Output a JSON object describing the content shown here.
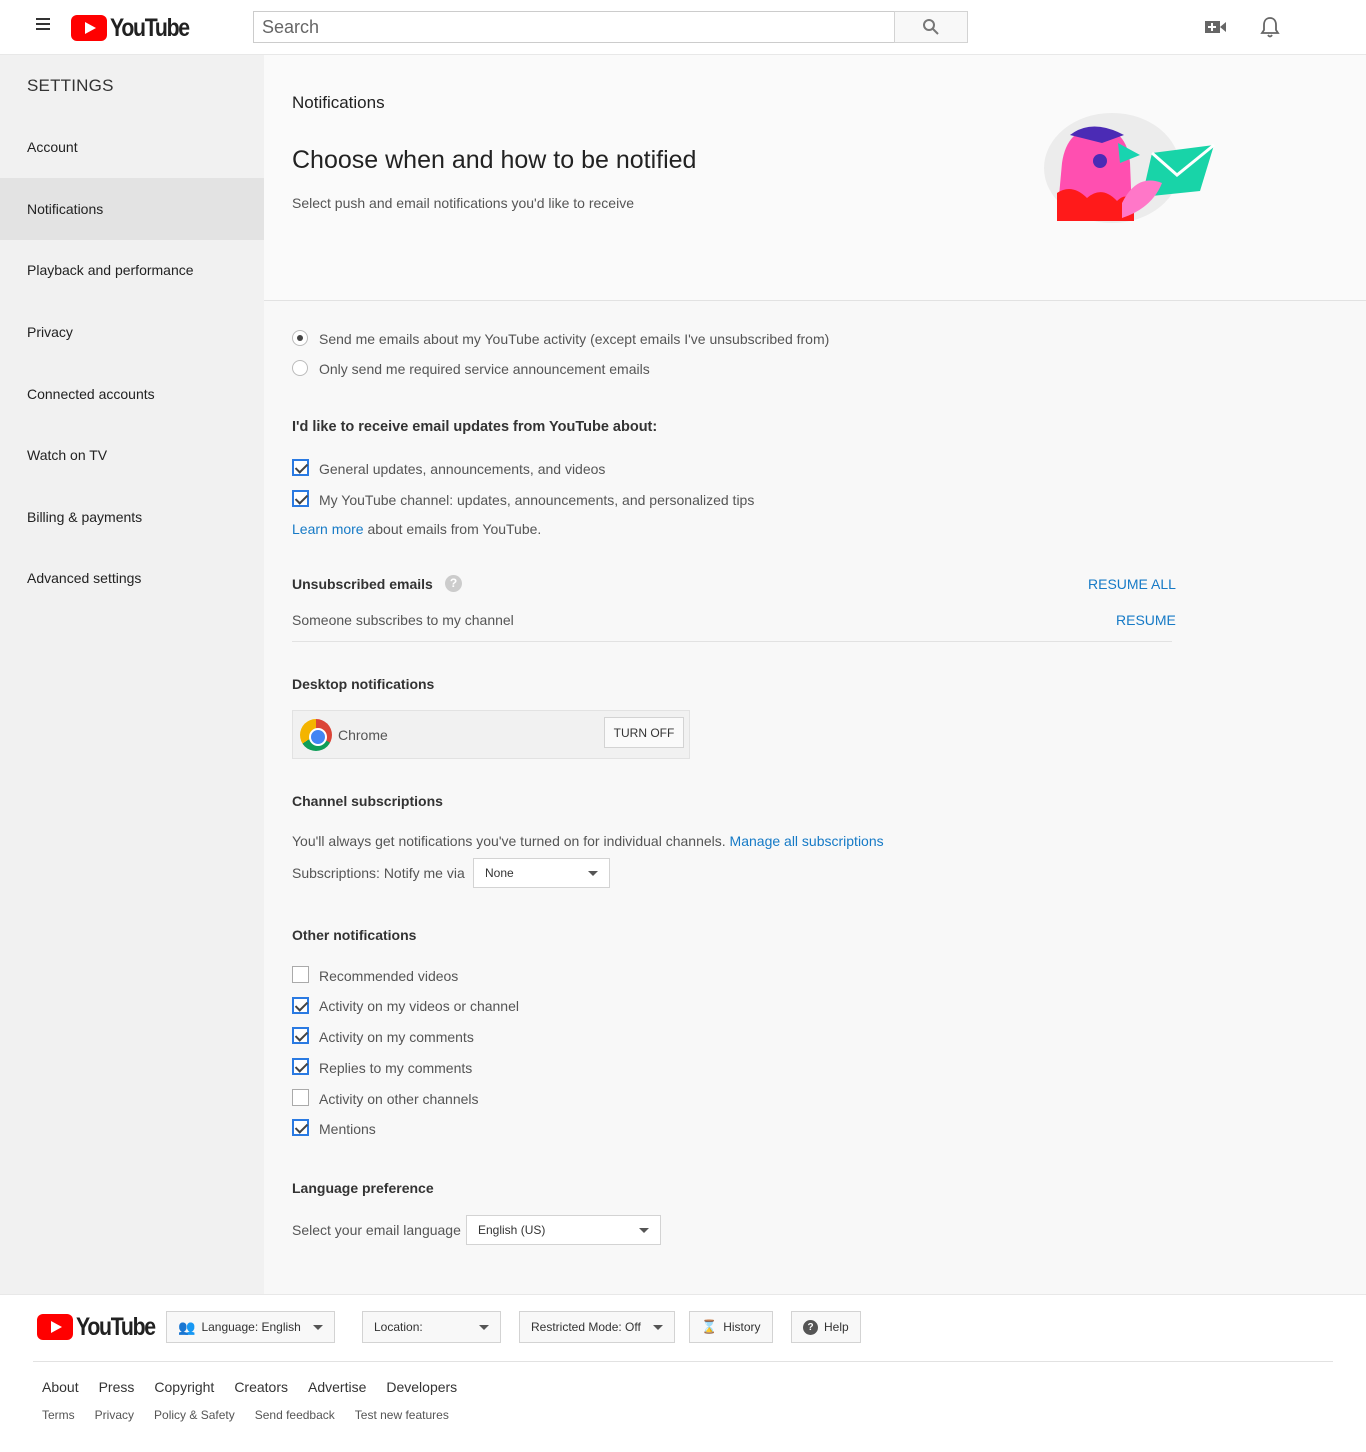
{
  "masthead": {
    "logo_text": "YouTube",
    "search_placeholder": "Search",
    "icons": {
      "menu": "hamburger-icon",
      "search": "search-icon",
      "upload": "video-camera-plus-icon",
      "notifications": "bell-icon"
    }
  },
  "sidebar": {
    "title": "SETTINGS",
    "items": [
      {
        "label": "Account"
      },
      {
        "label": "Notifications",
        "active": true
      },
      {
        "label": "Playback and performance"
      },
      {
        "label": "Privacy"
      },
      {
        "label": "Connected accounts"
      },
      {
        "label": "Watch on TV"
      },
      {
        "label": "Billing & payments"
      },
      {
        "label": "Advanced settings"
      }
    ]
  },
  "header": {
    "section": "Notifications",
    "title": "Choose when and how to be notified",
    "subtitle": "Select push and email notifications you'd like to receive"
  },
  "email_options": {
    "radios": [
      {
        "label": "Send me emails about my YouTube activity (except emails I've unsubscribed from)",
        "selected": true
      },
      {
        "label": "Only send me required service announcement emails",
        "selected": false
      }
    ],
    "updates_heading": "I'd like to receive email updates from YouTube about:",
    "updates": [
      {
        "label": "General updates, announcements, and videos",
        "checked": true
      },
      {
        "label": "My YouTube channel: updates, announcements, and personalized tips",
        "checked": true
      }
    ],
    "learn_more_link": "Learn more",
    "learn_more_rest": " about emails from YouTube."
  },
  "unsubscribed": {
    "heading": "Unsubscribed emails",
    "resume_all": "RESUME ALL",
    "item": "Someone subscribes to my channel",
    "resume": "RESUME"
  },
  "desktop": {
    "heading": "Desktop notifications",
    "browser": "Chrome",
    "turn_off": "TURN OFF"
  },
  "channel_subs": {
    "heading": "Channel subscriptions",
    "text": "You'll always get notifications you've turned on for individual channels.",
    "manage_link": "Manage all subscriptions",
    "notify_label": "Subscriptions: Notify me via",
    "notify_value": "None"
  },
  "other": {
    "heading": "Other notifications",
    "items": [
      {
        "label": "Recommended videos",
        "checked": false
      },
      {
        "label": "Activity on my videos or channel",
        "checked": true
      },
      {
        "label": "Activity on my comments",
        "checked": true
      },
      {
        "label": "Replies to my comments",
        "checked": true
      },
      {
        "label": "Activity on other channels",
        "checked": false
      },
      {
        "label": "Mentions",
        "checked": true
      }
    ]
  },
  "language": {
    "heading": "Language preference",
    "label": "Select your email language",
    "value": "English (US)"
  },
  "footer": {
    "logo_text": "YouTube",
    "language_btn": "Language: English",
    "location_btn": "Location:",
    "restricted_btn": "Restricted Mode: Off",
    "history_btn": "History",
    "help_btn": "Help",
    "links_primary": [
      "About",
      "Press",
      "Copyright",
      "Creators",
      "Advertise",
      "Developers"
    ],
    "links_secondary": [
      "Terms",
      "Privacy",
      "Policy & Safety",
      "Send feedback",
      "Test new features"
    ]
  }
}
